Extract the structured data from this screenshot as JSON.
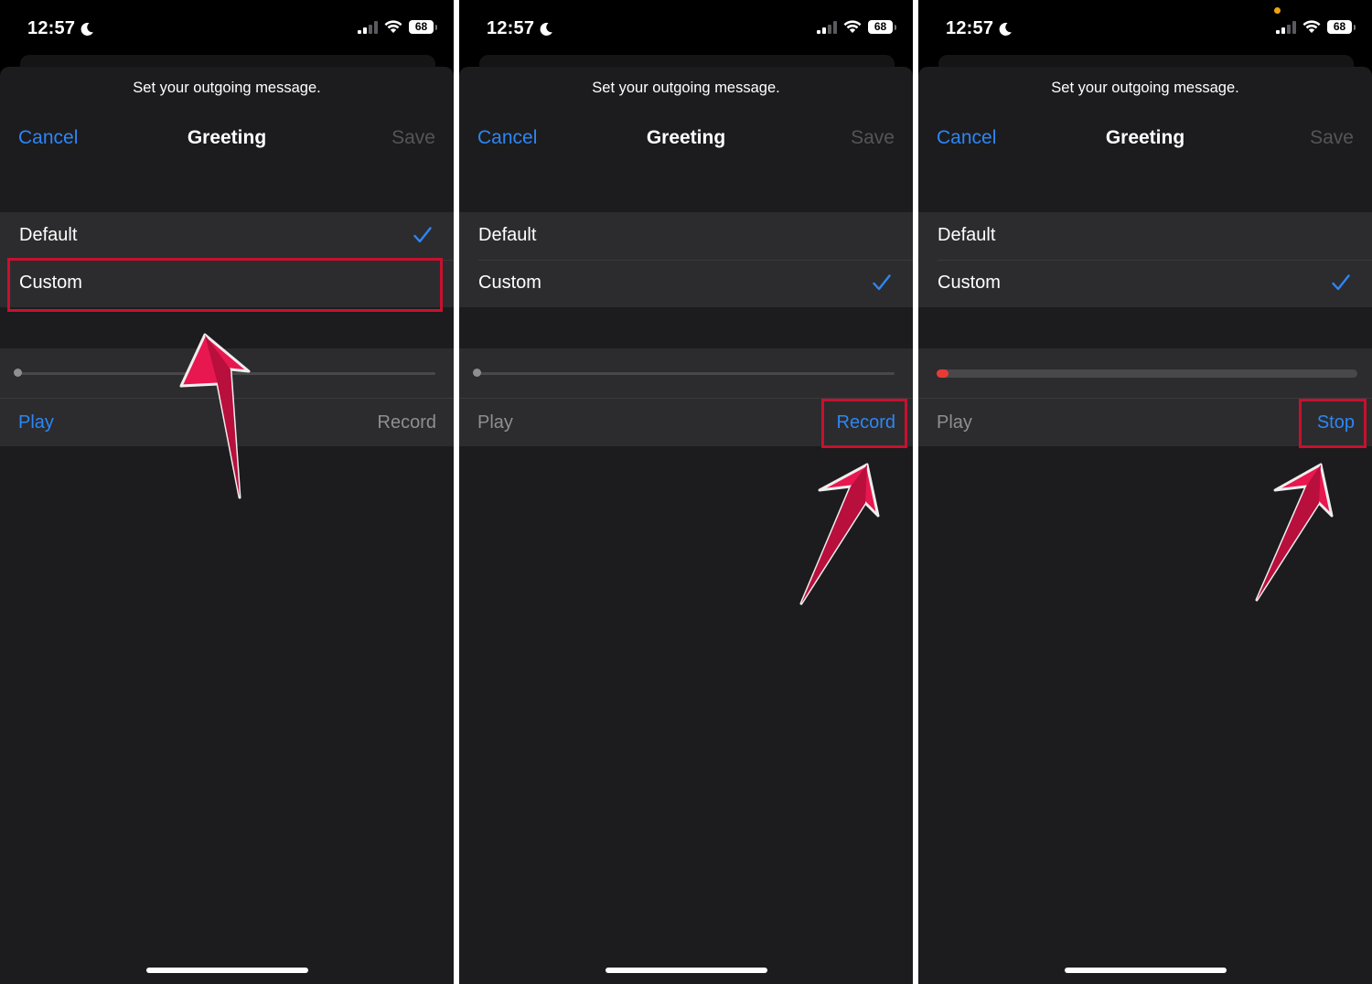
{
  "status": {
    "time": "12:57",
    "battery": "68"
  },
  "sheet": {
    "prompt": "Set your outgoing message.",
    "cancel_label": "Cancel",
    "title": "Greeting",
    "save_label": "Save"
  },
  "options": {
    "default_label": "Default",
    "custom_label": "Custom"
  },
  "player": {
    "play_label": "Play",
    "record_label": "Record",
    "stop_label": "Stop"
  },
  "panels": [
    {
      "selected": "Default",
      "highlight": "Custom",
      "right_button": "Record",
      "recording": false
    },
    {
      "selected": "Custom",
      "highlight": "Record",
      "right_button": "Record",
      "recording": false
    },
    {
      "selected": "Custom",
      "highlight": "Stop",
      "right_button": "Stop",
      "recording": true,
      "recording_progress": 0.03
    }
  ],
  "colors": {
    "accent": "#2d86f5",
    "highlight": "#c8102e",
    "arrow": "#e8174f",
    "recording": "#e83b36",
    "mic_indicator": "#f0a30a"
  },
  "icons": [
    "moon-icon",
    "cellular-signal-icon",
    "wifi-icon",
    "battery-icon",
    "checkmark-icon",
    "annotation-arrow-icon"
  ]
}
